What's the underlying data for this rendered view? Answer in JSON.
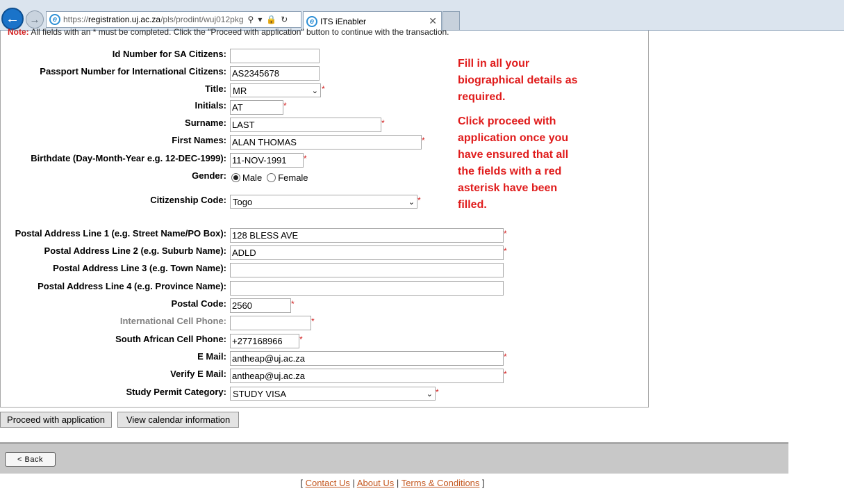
{
  "browser": {
    "url_prefix": "https://",
    "url_domain": "registration.uj.ac.za",
    "url_path": "/pls/prodint/wuj012pkg",
    "tab_title": "ITS iEnabler"
  },
  "note": {
    "label": "Note:",
    "text": "All fields with an * must be completed. Click the \"Proceed with application\" button to continue with the transaction."
  },
  "form": {
    "id_number": {
      "label": "Id Number for SA Citizens:",
      "value": ""
    },
    "passport": {
      "label": "Passport Number for International Citizens:",
      "value": "AS2345678"
    },
    "title": {
      "label": "Title:",
      "value": "MR"
    },
    "initials": {
      "label": "Initials:",
      "value": "AT"
    },
    "surname": {
      "label": "Surname:",
      "value": "LAST"
    },
    "first_names": {
      "label": "First Names:",
      "value": "ALAN THOMAS"
    },
    "birthdate": {
      "label": "Birthdate (Day-Month-Year e.g. 12-DEC-1999):",
      "value": "11-NOV-1991"
    },
    "gender": {
      "label": "Gender:",
      "options": [
        "Male",
        "Female"
      ],
      "selected": "Male"
    },
    "citizenship": {
      "label": "Citizenship Code:",
      "value": "Togo"
    },
    "postal1": {
      "label": "Postal Address Line 1 (e.g. Street Name/PO Box):",
      "value": "128 BLESS AVE"
    },
    "postal2": {
      "label": "Postal Address Line 2 (e.g. Suburb Name):",
      "value": "ADLD"
    },
    "postal3": {
      "label": "Postal Address Line 3 (e.g. Town Name):",
      "value": ""
    },
    "postal4": {
      "label": "Postal Address Line 4 (e.g. Province Name):",
      "value": ""
    },
    "postal_code": {
      "label": "Postal Code:",
      "value": "2560"
    },
    "intl_cell": {
      "label": "International Cell Phone:",
      "value": ""
    },
    "sa_cell": {
      "label": "South African Cell Phone:",
      "value": "+277168966"
    },
    "email": {
      "label": "E Mail:",
      "value": "antheap@uj.ac.za"
    },
    "verify_email": {
      "label": "Verify E Mail:",
      "value": "antheap@uj.ac.za"
    },
    "study_permit": {
      "label": "Study Permit Category:",
      "value": "STUDY VISA"
    },
    "required_mark": "*"
  },
  "hint": {
    "para1": "Fill in all your biographical details as required.",
    "para2": "Click proceed with application once you have ensured that all the fields with a red asterisk have been filled."
  },
  "buttons": {
    "proceed": "Proceed with application",
    "calendar": "View calendar information",
    "back": "< Back"
  },
  "footer": {
    "open": "[",
    "sep": "|",
    "close": "]",
    "contact": "Contact Us",
    "about": "About Us",
    "terms": "Terms & Conditions"
  },
  "colors": {
    "required": "#d21f1f",
    "hint_text": "#e01c1c",
    "footer_link": "#c4571f"
  },
  "icons": [
    "back-arrow-icon",
    "forward-arrow-icon",
    "ie-logo-icon",
    "search-icon",
    "lock-icon",
    "refresh-icon",
    "close-icon",
    "chevron-down-icon"
  ]
}
